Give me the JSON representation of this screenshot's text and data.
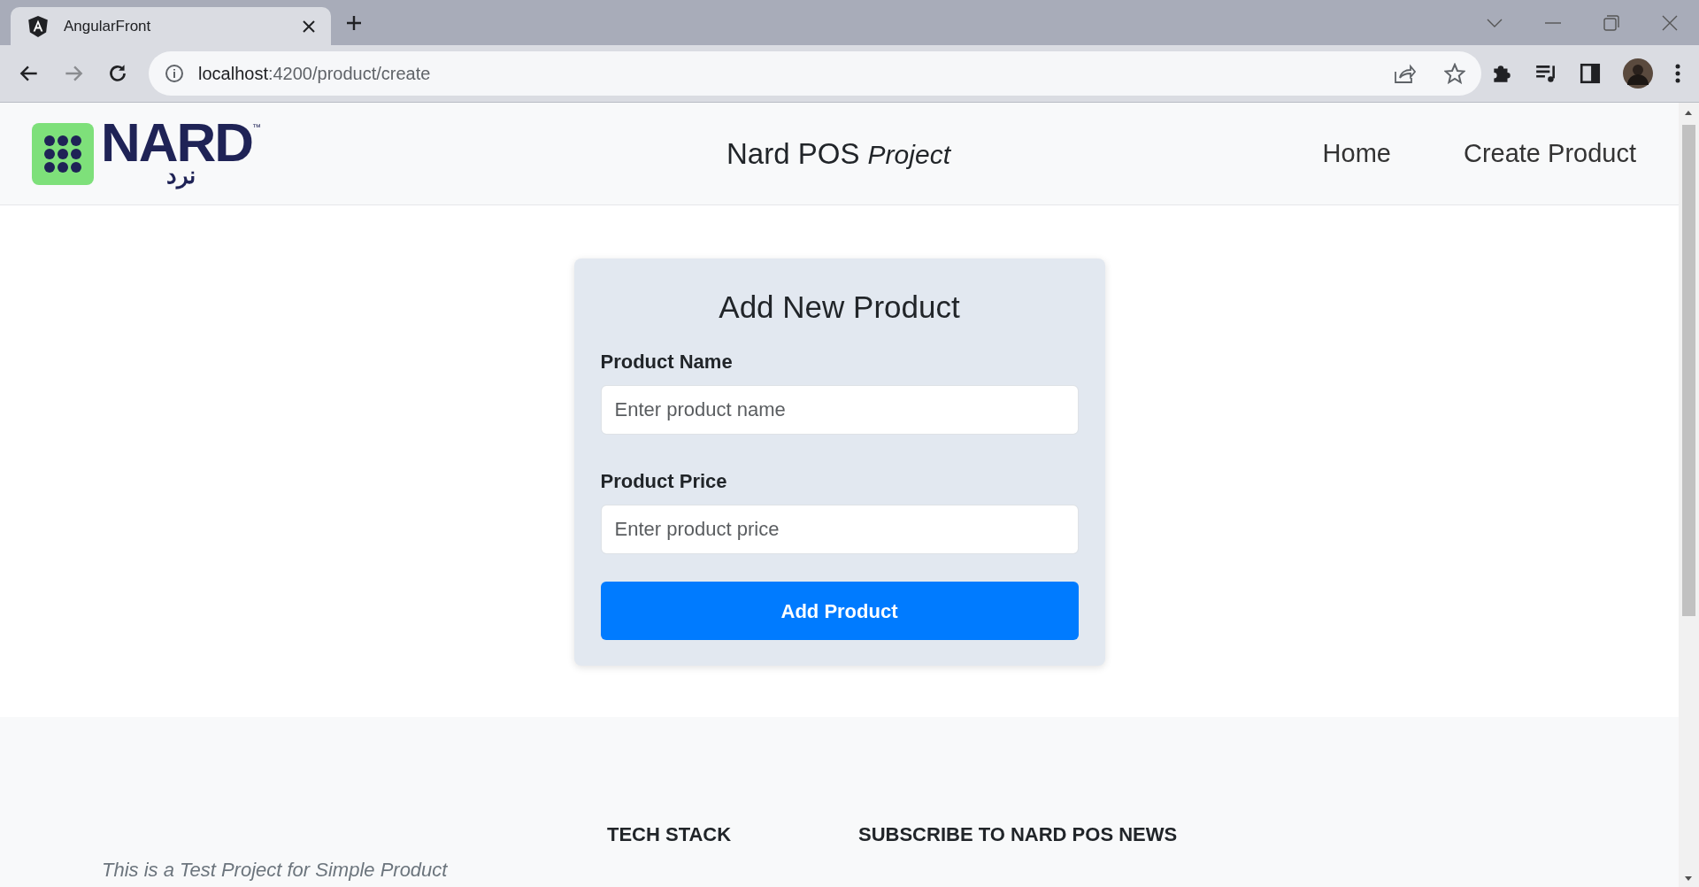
{
  "browser": {
    "tab_title": "AngularFront",
    "url_host": "localhost",
    "url_path": ":4200/product/create"
  },
  "header": {
    "logo_text": "NARD",
    "logo_mark": "™",
    "logo_arabic": "نرد",
    "title": "Nard POS",
    "title_suffix": "Project",
    "nav": [
      {
        "label": "Home"
      },
      {
        "label": "Create Product"
      }
    ]
  },
  "form": {
    "title": "Add New Product",
    "fields": [
      {
        "label": "Product Name",
        "placeholder": "Enter product name"
      },
      {
        "label": "Product Price",
        "placeholder": "Enter product price"
      }
    ],
    "submit": "Add Product"
  },
  "footer": {
    "about": "This is a Test Project for Simple Product",
    "headings": [
      "TECH STACK",
      "SUBSCRIBE TO NARD POS NEWS"
    ]
  }
}
